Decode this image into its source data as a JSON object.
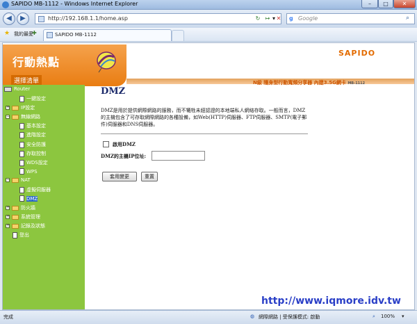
{
  "window": {
    "title": "SAPIDO MB-1112 - Windows Internet Explorer"
  },
  "toolbar": {
    "address": "http://192.168.1.1/home.asp",
    "search_placeholder": "Google",
    "favorites_label": "我的最愛",
    "tab_title": "SAPIDO MB-1112"
  },
  "header": {
    "app_name": "行動熱點",
    "menu_label": "選擇清單",
    "logo": "SAPIDO",
    "product_line": "N級 隨身型行動寬頻分享器 內建3.5G網卡",
    "model": "MB-1112"
  },
  "sidebar": {
    "items": [
      {
        "label": "Router",
        "kind": "root"
      },
      {
        "label": "一鍵設定",
        "kind": "page"
      },
      {
        "label": "IP設定",
        "kind": "folder"
      },
      {
        "label": "無線網路",
        "kind": "folder-open"
      },
      {
        "label": "基本設定",
        "kind": "subpage"
      },
      {
        "label": "進階設定",
        "kind": "subpage"
      },
      {
        "label": "安全防護",
        "kind": "subpage"
      },
      {
        "label": "存取控制",
        "kind": "subpage"
      },
      {
        "label": "WDS設定",
        "kind": "subpage"
      },
      {
        "label": "WPS",
        "kind": "subpage"
      },
      {
        "label": "NAT",
        "kind": "folder-open"
      },
      {
        "label": "虛擬伺服器",
        "kind": "subpage"
      },
      {
        "label": "DMZ",
        "kind": "subpage-selected"
      },
      {
        "label": "防火牆",
        "kind": "folder"
      },
      {
        "label": "系統管理",
        "kind": "folder"
      },
      {
        "label": "記錄及狀態",
        "kind": "folder"
      },
      {
        "label": "登出",
        "kind": "page"
      }
    ]
  },
  "main": {
    "title": "DMZ",
    "description": "DMZ是用於提供網際網路的服務，而不犧牲未經認證的本地端私人網絡存取。一般而言，DMZ的主機包含了可存取網際網路的各種設備，如Web(HTTP)伺服器、FTP伺服器、SMTP(電子郵件)伺服器和DNS伺服器。",
    "enable_dmz_label": "啟用DMZ",
    "enable_dmz_checked": false,
    "host_ip_label": "DMZ的主機IP位址:",
    "host_ip_value": "",
    "apply_button": "套用變更",
    "reset_button": "重置"
  },
  "watermark": "http://www.iqmore.idv.tw",
  "statusbar": {
    "left": "完成",
    "zone": "網際網路 | 受保護模式: 啟動",
    "zoom": "100%"
  },
  "colors": {
    "orange": "#e97d12",
    "sidebar_green": "#8cc63f",
    "title_navy": "#1c2a6a",
    "watermark_blue": "#2a3fc7"
  }
}
